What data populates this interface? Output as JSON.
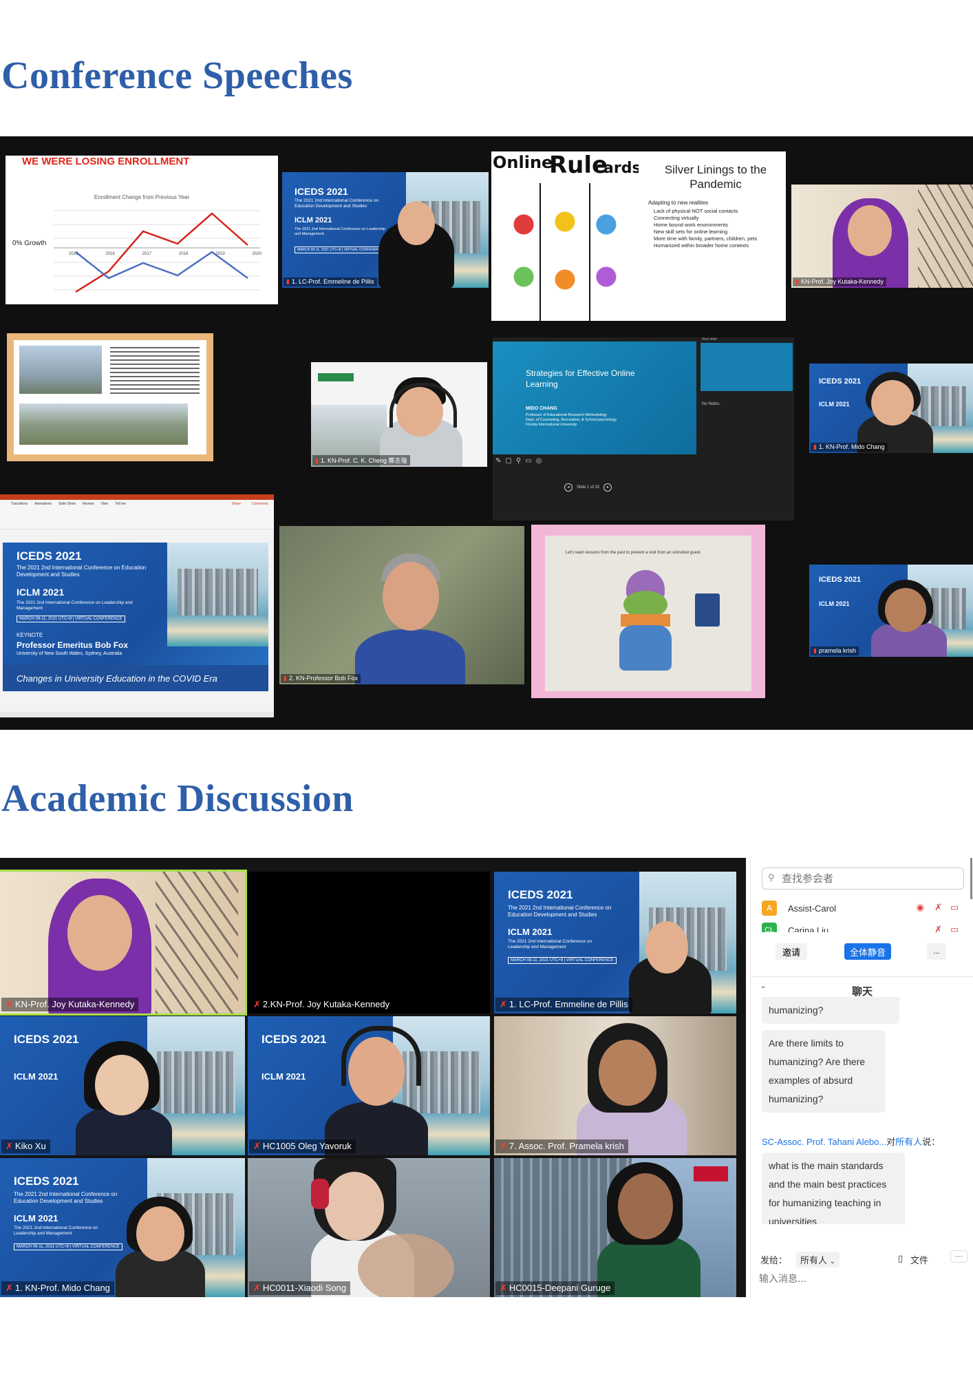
{
  "section1": {
    "title": "Conference  Speeches"
  },
  "section2": {
    "title": "Academic Discussion"
  },
  "slides": {
    "enrollment": {
      "heading": "WE WERE LOSING ENROLLMENT",
      "chart_title": "Enrollment Change from Previous Year",
      "growth_label": "0% Growth",
      "years": [
        "2015",
        "2016",
        "2017",
        "2018",
        "2019",
        "2020"
      ]
    },
    "silver": {
      "title": "Silver Linings to the Pandemic",
      "bullet": "Adapting to new realities",
      "subs": [
        "Lack of physical NOT social contacts",
        "Connecting virtually",
        "Home bound work environments",
        "New skill sets for online learning",
        "More time with family, partners, children, pets",
        "Humanized within broader home contexts"
      ]
    },
    "rules": {
      "title1": "Online",
      "title2": "Rule",
      "title3": "cards"
    },
    "strategies": {
      "title": "Strategies for Effective Online Learning",
      "author": "MIDO CHANG",
      "affil": "Professor of Educational Research Methodology\nDept. of Counseling, Recreation, & School psychology\nFlorida International University",
      "notes": "No Notes.",
      "slide_counter": "Slide 1 of 32",
      "next_slide": "Next slide"
    },
    "passport": {
      "caption": "Let's learn lessons from the past to prevent a visit from an uninvited guest."
    },
    "keynote": {
      "label": "KEYNOTE",
      "speaker": "Professor Emeritus Bob Fox",
      "affil": "University of New South Wales, Sydney, Australia",
      "talk": "Changes in University Education in the COVID Era",
      "ribbon_menu": [
        "Transitions",
        "Animations",
        "Slide Show",
        "Review",
        "View",
        "Tell me"
      ],
      "share": "Share",
      "comments": "Comments"
    }
  },
  "banner": {
    "iceds": "ICEDS 2021",
    "iceds_full": "The 2021 2nd International Conference on Education Development and Studies",
    "iclm": "ICLM 2021",
    "iclm_full": "The 2021 2nd International Conference on Leadership and Management",
    "dates": "MARCH 09-11, 2021 UTC+8 | VIRTUAL CONFERENCE"
  },
  "speech_tiles": {
    "t1": "1. LC-Prof. Emmeline de Pillis",
    "t2": "KN-Prof. Joy Kutaka-Kennedy",
    "t3": "1. KN-Prof. C. K. Cheng 鄭志強",
    "t4": "1. KN-Prof. Mido Chang",
    "t5": "2. KN-Professor Bob Fox",
    "t6": "pramela krish"
  },
  "discussion_tiles": [
    "KN-Prof. Joy Kutaka-Kennedy",
    "2.KN-Prof. Joy Kutaka-Kennedy",
    "1. LC-Prof. Emmeline de Pillis",
    "Kiko Xu",
    "HC1005 Oleg Yavoruk",
    "7. Assoc. Prof. Pramela krish",
    "1. KN-Prof. Mido Chang",
    "HC0011-Xiaodi Song",
    "HC0015-Deepani Guruge"
  ],
  "sidebar": {
    "search_placeholder": "查找参会者",
    "participants": [
      {
        "initial": "A",
        "name": "Assist-Carol",
        "color": "#f5a623"
      },
      {
        "initial": "CL",
        "name": "Carina Liu",
        "color": "#2bb24c"
      }
    ],
    "invite": "邀请",
    "mute_all": "全体静音",
    "more": "...",
    "chat_title": "聊天",
    "messages": [
      {
        "text": "humanizing?"
      },
      {
        "text": "Are there limits to humanizing? Are there examples of absurd humanizing?"
      }
    ],
    "sender": "SC-Assoc. Prof. Tahani Alebo...",
    "sender_to": "对",
    "sender_target": "所有人",
    "sender_says": "说：",
    "last_message": "what is the main standards and the main best practices for humanizing teaching in universities",
    "send_to_label": "发给：",
    "send_to_value": "所有人",
    "file": "文件",
    "input_placeholder": "输入消息..."
  },
  "colors": {
    "heading": "#2e5fa8",
    "mute_all_bg": "#1a73e8"
  }
}
